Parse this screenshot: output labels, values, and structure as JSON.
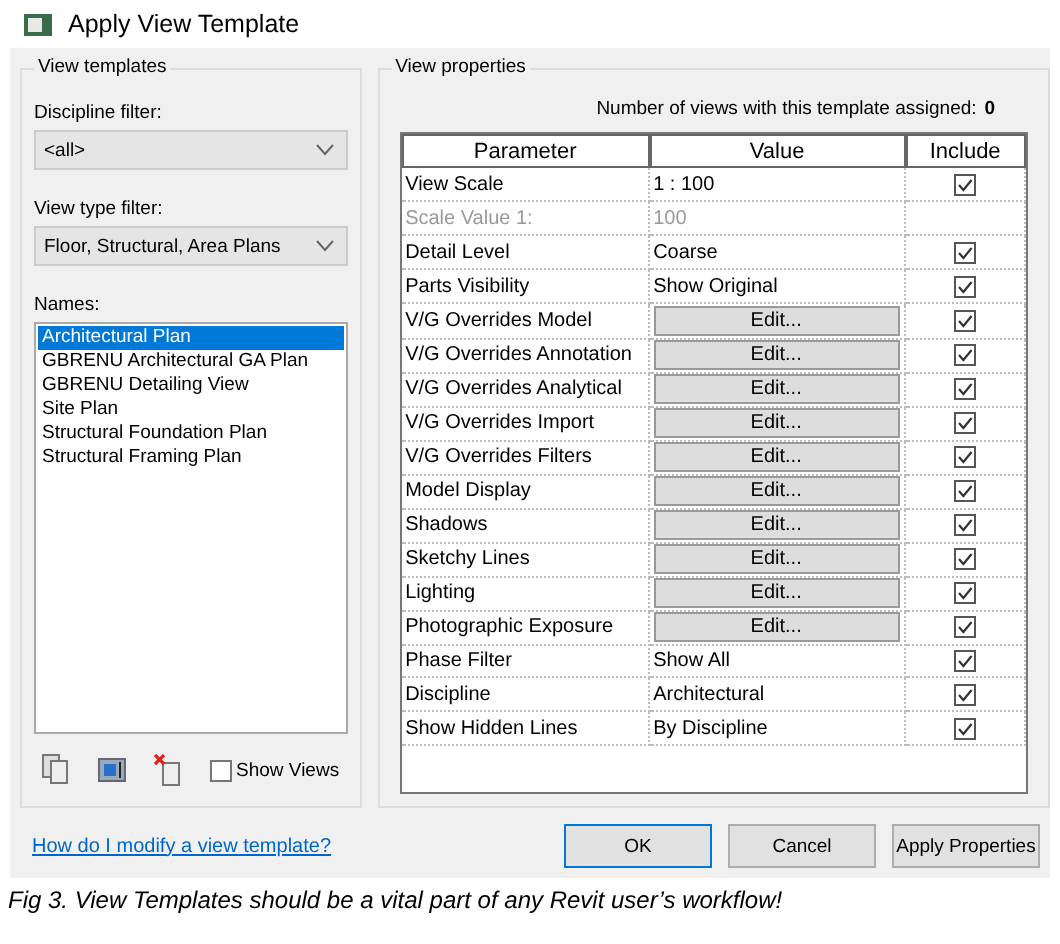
{
  "window": {
    "title": "Apply View Template"
  },
  "view_templates": {
    "title": "View templates",
    "discipline_label": "Discipline filter:",
    "discipline_value": "<all>",
    "view_type_label": "View type filter:",
    "view_type_value": "Floor, Structural, Area Plans",
    "names_label": "Names:",
    "names": [
      {
        "label": "Architectural Plan",
        "selected": true
      },
      {
        "label": "GBRENU Architectural GA Plan",
        "selected": false
      },
      {
        "label": "GBRENU Detailing View",
        "selected": false
      },
      {
        "label": "Site Plan",
        "selected": false
      },
      {
        "label": "Structural Foundation Plan",
        "selected": false
      },
      {
        "label": "Structural Framing Plan",
        "selected": false
      }
    ],
    "show_views": {
      "label": "Show Views",
      "checked": false
    }
  },
  "view_properties": {
    "title": "View properties",
    "count_label": "Number of views with this template assigned:",
    "count": "0",
    "columns": [
      "Parameter",
      "Value",
      "Include"
    ],
    "rows": [
      {
        "parameter": "View Scale",
        "value": "1 : 100",
        "kind": "text",
        "include": true
      },
      {
        "parameter": "Scale Value    1:",
        "value": "100",
        "kind": "disabled"
      },
      {
        "parameter": "Detail Level",
        "value": "Coarse",
        "kind": "text",
        "include": true
      },
      {
        "parameter": "Parts Visibility",
        "value": "Show Original",
        "kind": "text",
        "include": true
      },
      {
        "parameter": "V/G Overrides Model",
        "value": "Edit...",
        "kind": "button",
        "include": true
      },
      {
        "parameter": "V/G Overrides Annotation",
        "value": "Edit...",
        "kind": "button",
        "include": true
      },
      {
        "parameter": "V/G Overrides Analytical",
        "value": "Edit...",
        "kind": "button",
        "include": true
      },
      {
        "parameter": "V/G Overrides Import",
        "value": "Edit...",
        "kind": "button",
        "include": true
      },
      {
        "parameter": "V/G Overrides Filters",
        "value": "Edit...",
        "kind": "button",
        "include": true
      },
      {
        "parameter": "Model Display",
        "value": "Edit...",
        "kind": "button",
        "include": true
      },
      {
        "parameter": "Shadows",
        "value": "Edit...",
        "kind": "button",
        "include": true
      },
      {
        "parameter": "Sketchy Lines",
        "value": "Edit...",
        "kind": "button",
        "include": true
      },
      {
        "parameter": "Lighting",
        "value": "Edit...",
        "kind": "button",
        "include": true
      },
      {
        "parameter": "Photographic Exposure",
        "value": "Edit...",
        "kind": "button",
        "include": true
      },
      {
        "parameter": "Phase Filter",
        "value": "Show All",
        "kind": "text",
        "include": true
      },
      {
        "parameter": "Discipline",
        "value": "Architectural",
        "kind": "text",
        "include": true
      },
      {
        "parameter": "Show Hidden Lines",
        "value": "By Discipline",
        "kind": "text",
        "include": true
      }
    ]
  },
  "help_link": "How do I modify a view template?",
  "buttons": [
    "OK",
    "Cancel",
    "Apply Properties"
  ],
  "caption": "Fig 3. View Templates should be a vital part of any Revit user’s workflow!"
}
